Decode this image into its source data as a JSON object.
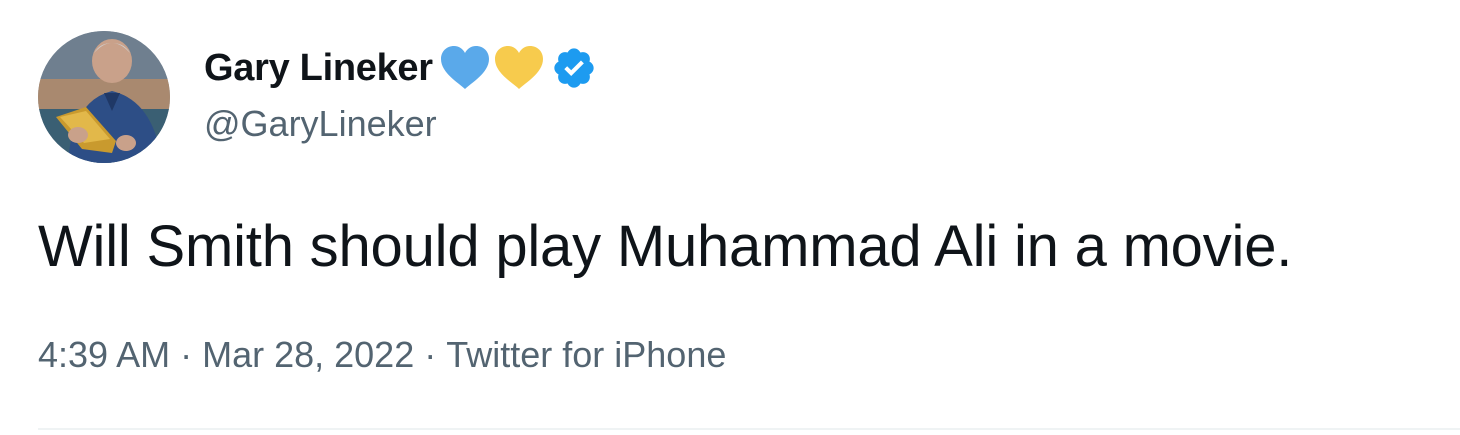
{
  "author": {
    "display_name": "Gary Lineker",
    "handle": "@GaryLineker",
    "verified": true,
    "name_emojis": [
      "blue-heart-icon",
      "yellow-heart-icon"
    ],
    "colors": {
      "blue_heart": "#5aa9ea",
      "yellow_heart": "#f7cb4d",
      "verified_badge": "#1d9bf0"
    }
  },
  "tweet": {
    "text": "Will Smith should play Muhammad Ali in a movie."
  },
  "meta": {
    "time": "4:39 AM",
    "date": "Mar 28, 2022",
    "source": "Twitter for iPhone",
    "separator": "·"
  }
}
